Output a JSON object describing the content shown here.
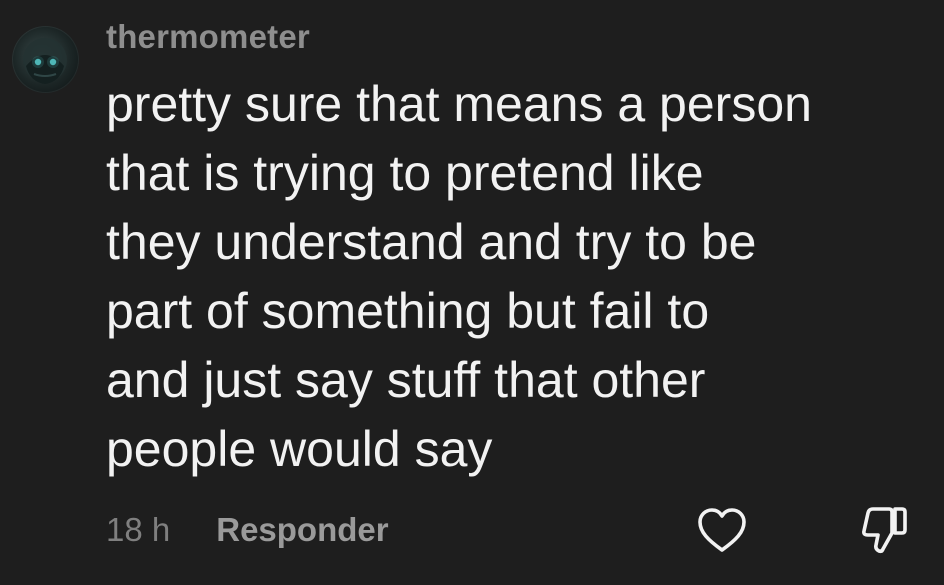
{
  "comment": {
    "username": "thermometer",
    "text": "pretty sure that means a person\nthat is trying to pretend like\nthey understand and try to be\npart of something but fail to\nand just say stuff that other\npeople would say",
    "time": "18 h",
    "reply_label": "Responder"
  },
  "icons": {
    "like": "heart-outline-icon",
    "dislike": "thumbs-down-outline-icon",
    "avatar": "user-avatar"
  },
  "colors": {
    "background": "#1e1e1e",
    "text": "#f2f2f2",
    "muted": "#8e8e8e"
  }
}
